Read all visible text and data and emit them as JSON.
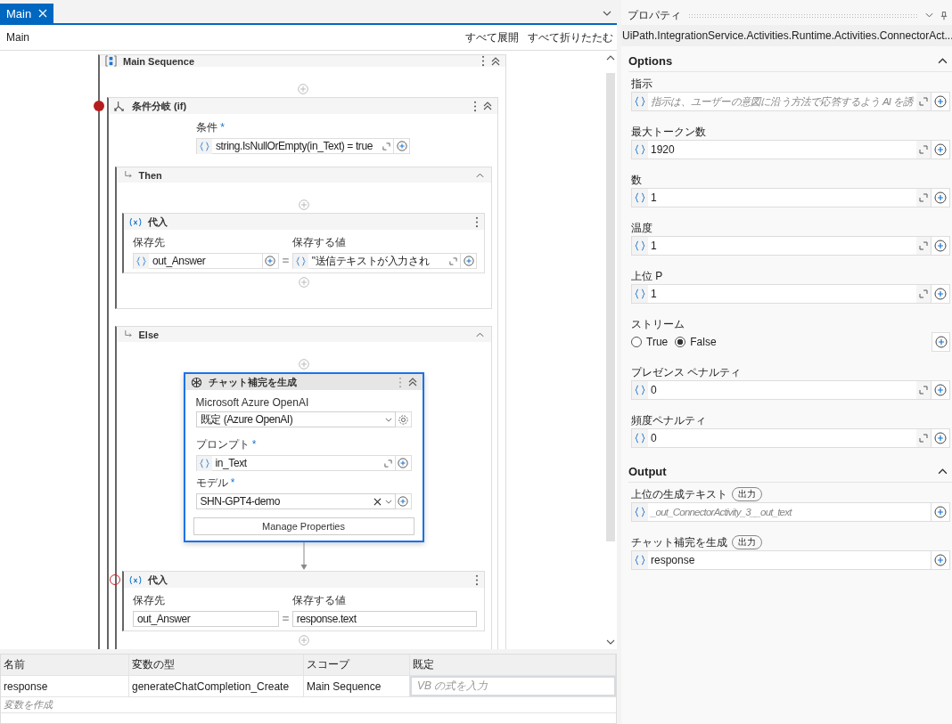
{
  "tabs": [
    {
      "label": "Main",
      "selected": true
    }
  ],
  "breadcrumb": "Main",
  "toolbar": [
    "すべて展開",
    "すべて折りたたむ"
  ],
  "sequence": {
    "title": "Main Sequence",
    "if": {
      "title": "条件分岐 (if)",
      "breakpoint": true,
      "breakpoint_enabled": true,
      "condition": {
        "label": "条件",
        "required_mark": "*",
        "value": "string.IsNullOrEmpty(in_Text) = true"
      },
      "then": {
        "title": "Then",
        "assign": {
          "title": "代入",
          "to": {
            "label": "保存先",
            "value": "out_Answer",
            "kind": "expression",
            "expandable": false
          },
          "value": {
            "label": "保存する値",
            "value": "\"送信テキストが入力され",
            "kind": "expression",
            "expandable": true
          }
        }
      },
      "else": {
        "title": "Else",
        "chat": {
          "title": "チャット補完を生成",
          "selected": true,
          "connection": {
            "label": "Microsoft Azure OpenAI",
            "value": "既定 (Azure OpenAI)"
          },
          "prompt": {
            "label": "プロンプト",
            "required_mark": "*",
            "value": "in_Text"
          },
          "model": {
            "label": "モデル",
            "required_mark": "*",
            "value": "SHN-GPT4-demo"
          },
          "button": "Manage Properties"
        },
        "assign": {
          "title": "代入",
          "breakpoint": true,
          "breakpoint_enabled": false,
          "to": {
            "label": "保存先",
            "value": "out_Answer",
            "kind": "plain",
            "expandable": false
          },
          "value": {
            "label": "保存する値",
            "value": "response.text",
            "kind": "plain",
            "expandable": false
          }
        }
      }
    }
  },
  "variables": {
    "columns": [
      "名前",
      "変数の型",
      "スコープ",
      "既定"
    ],
    "rows": [
      {
        "name": "response",
        "type": "generateChatCompletion_Create",
        "scope": "Main Sequence",
        "default_placeholder": "VB の式を入力"
      }
    ],
    "create_hint": "変数を作成"
  },
  "properties": {
    "title": "プロパティ",
    "type_name": "UiPath.IntegrationService.Activities.Runtime.Activities.ConnectorAct...",
    "sections": [
      {
        "title": "Options",
        "expanded": true,
        "items": [
          {
            "kind": "field",
            "label": "指示",
            "placeholder": "指示は、ユーザーの意図に沿う方法で応答するよう AI を誘",
            "expandable": true
          },
          {
            "kind": "field",
            "label": "最大トークン数",
            "value": "1920",
            "expandable": true
          },
          {
            "kind": "field",
            "label": "数",
            "value": "1",
            "expandable": true
          },
          {
            "kind": "field",
            "label": "温度",
            "value": "1",
            "expandable": true
          },
          {
            "kind": "field",
            "label": "上位 P",
            "value": "1",
            "expandable": true
          },
          {
            "kind": "radio",
            "label": "ストリーム",
            "options": [
              {
                "label": "True",
                "selected": false
              },
              {
                "label": "False",
                "selected": true
              }
            ]
          },
          {
            "kind": "field",
            "label": "プレゼンス ペナルティ",
            "value": "0",
            "expandable": true
          },
          {
            "kind": "field",
            "label": "頻度ペナルティ",
            "value": "0",
            "expandable": true
          }
        ]
      },
      {
        "title": "Output",
        "expanded": true,
        "items": [
          {
            "kind": "field",
            "label": "上位の生成テキスト",
            "badge": "出力",
            "placeholder": "_out_ConnectorActivity_3__out_text",
            "expandable": false
          },
          {
            "kind": "field",
            "label": "チャット補完を生成",
            "badge": "出力",
            "value": "response",
            "expandable": false
          }
        ]
      }
    ]
  }
}
